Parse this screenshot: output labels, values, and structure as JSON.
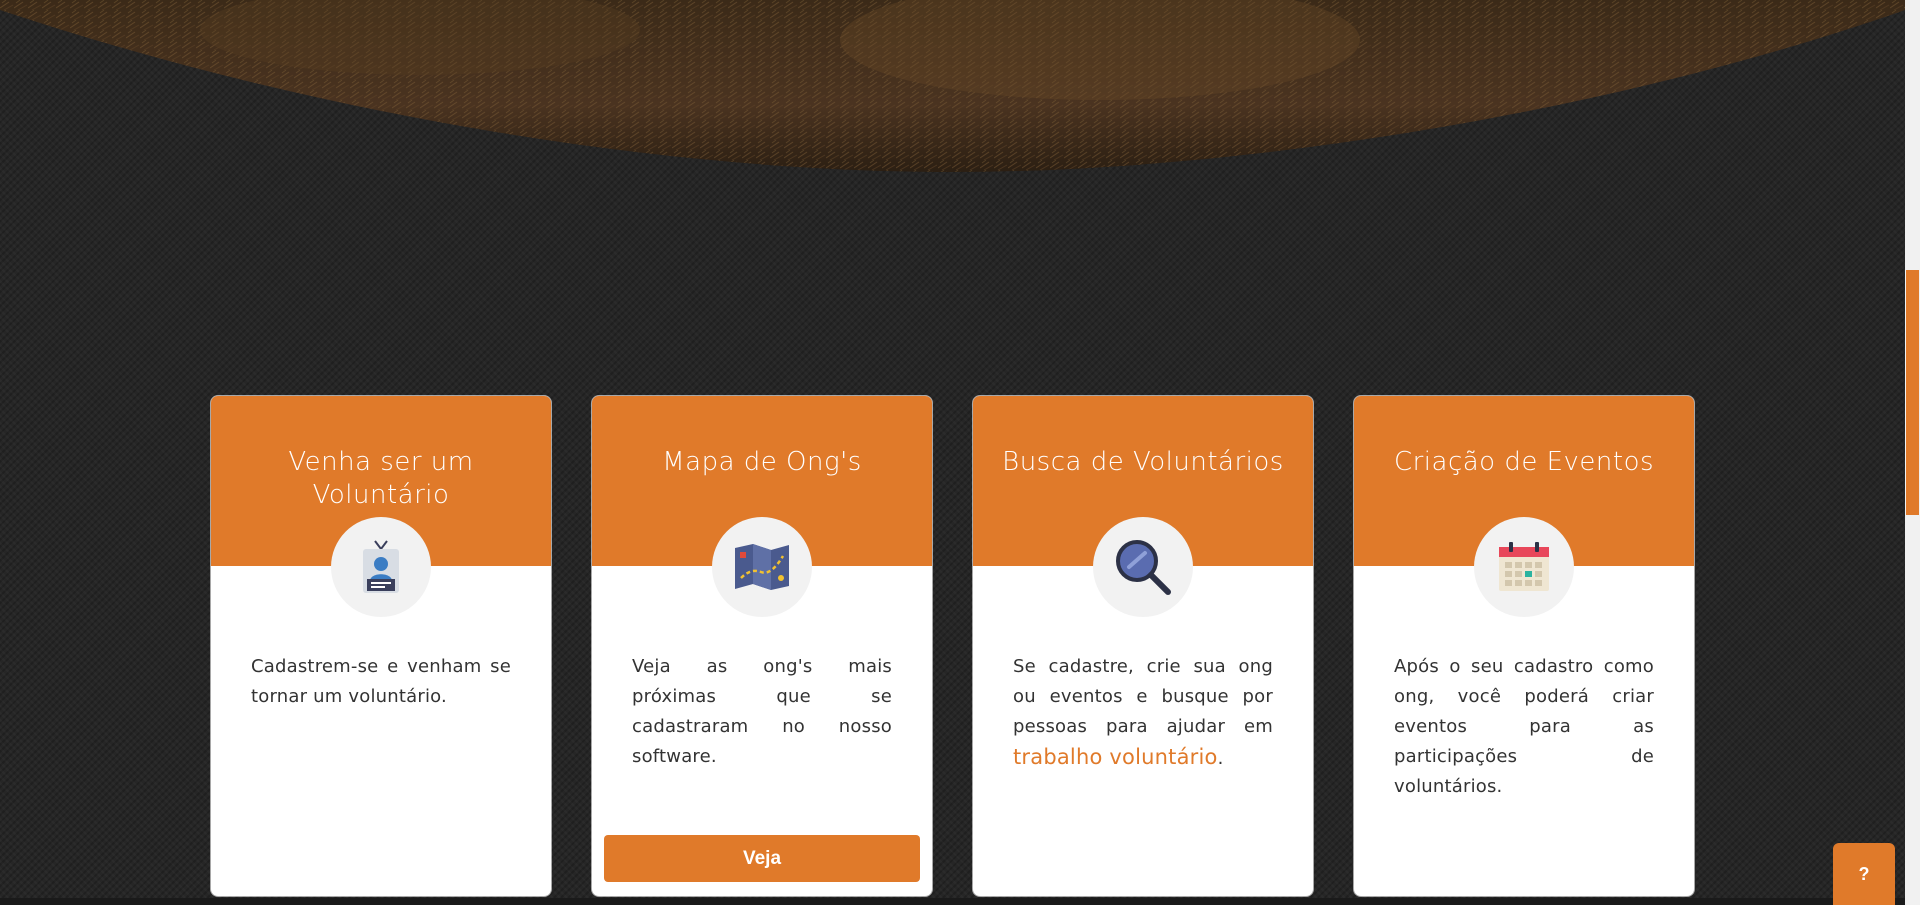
{
  "hero": {
    "image": "dry-grass-field-photo"
  },
  "cards": [
    {
      "title": "Venha ser um Voluntário",
      "icon": "volunteer-badge-icon",
      "text": "Cadastrem-se e venham se tornar um voluntário."
    },
    {
      "title": "Mapa de Ong's",
      "icon": "folded-map-icon",
      "text": "Veja as ong's mais próximas que se cadastraram no nosso software.",
      "button_label": "Veja"
    },
    {
      "title": "Busca de Voluntários",
      "icon": "magnifying-glass-icon",
      "text_before": "Se cadastre, crie sua ong ou eventos e busque por pessoas para ajudar em ",
      "text_highlight": "trabalho voluntário",
      "text_after": "."
    },
    {
      "title": "Criação de Eventos",
      "icon": "calendar-icon",
      "text": "Após o seu cadastro como ong, você poderá criar eventos para as participações de voluntários."
    }
  ],
  "help": {
    "label": "?"
  },
  "colors": {
    "accent": "#e07a2a",
    "background": "#262626",
    "card": "#ffffff"
  }
}
